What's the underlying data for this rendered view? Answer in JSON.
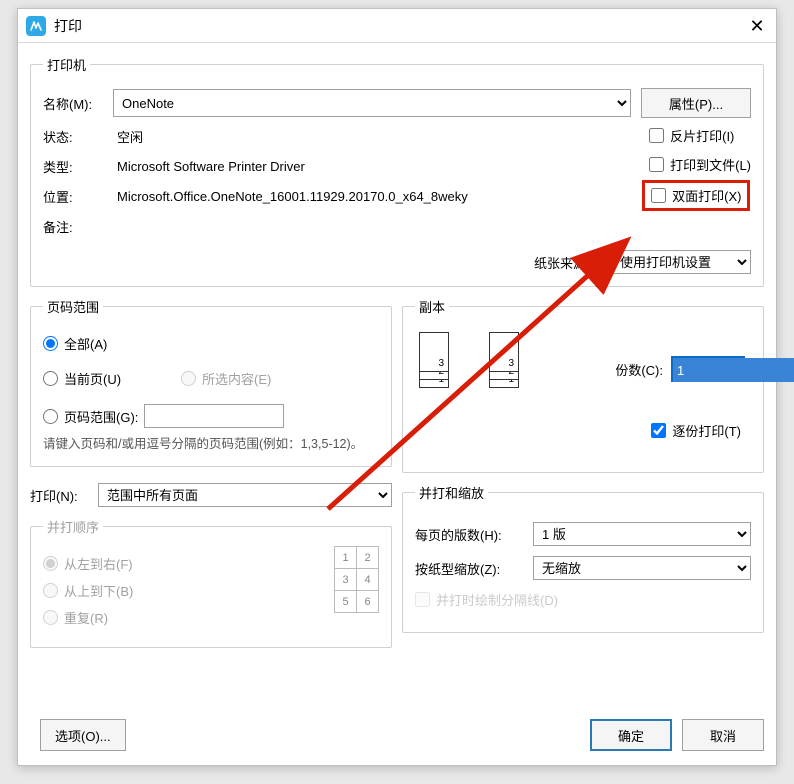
{
  "window": {
    "title": "打印",
    "close": "✕"
  },
  "printer": {
    "group_label": "打印机",
    "name_label": "名称(M):",
    "name_value": "OneNote",
    "properties_btn": "属性(P)...",
    "status_label": "状态:",
    "status_value": "空闲",
    "type_label": "类型:",
    "type_value": "Microsoft Software Printer Driver",
    "where_label": "位置:",
    "where_value": "Microsoft.Office.OneNote_16001.11929.20170.0_x64_8weky",
    "comment_label": "备注:",
    "comment_value": "",
    "cb_reverse": "反片打印(I)",
    "cb_tofile": "打印到文件(L)",
    "cb_duplex": "双面打印(X)",
    "paper_source_label": "纸张来源(S):",
    "paper_source_value": "使用打印机设置"
  },
  "page_range": {
    "group_label": "页码范围",
    "all": "全部(A)",
    "current": "当前页(U)",
    "selection": "所选内容(E)",
    "pages": "页码范围(G):",
    "hint": "请键入页码和/或用逗号分隔的页码范围(例如：1,3,5-12)。"
  },
  "copies": {
    "group_label": "副本",
    "copies_label": "份数(C):",
    "copies_value": "1",
    "collate_label": "逐份打印(T)"
  },
  "print_what": {
    "label": "打印(N):",
    "value": "范围中所有页面"
  },
  "order": {
    "group_label": "并打顺序",
    "lr": "从左到右(F)",
    "tb": "从上到下(B)",
    "repeat": "重复(R)"
  },
  "zoom": {
    "group_label": "并打和缩放",
    "per_sheet_label": "每页的版数(H):",
    "per_sheet_value": "1 版",
    "scale_label": "按纸型缩放(Z):",
    "scale_value": "无缩放",
    "draw_lines": "并打时绘制分隔线(D)"
  },
  "footer": {
    "options": "选项(O)...",
    "ok": "确定",
    "cancel": "取消"
  }
}
